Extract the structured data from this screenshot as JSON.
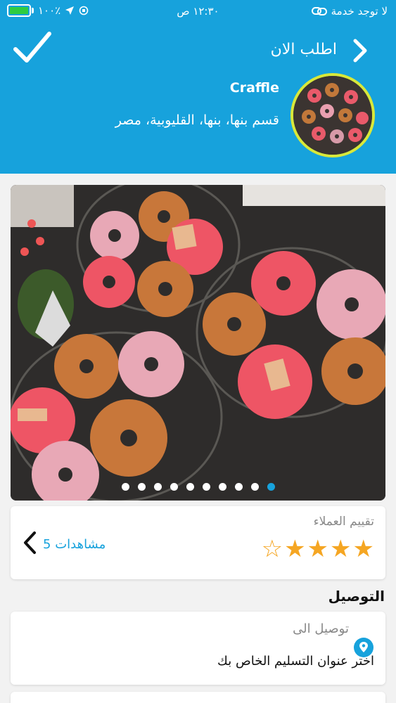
{
  "status_bar": {
    "carrier": "لا توجد خدمة",
    "time": "١٢:٣٠ ص",
    "battery": "١٠٠٪"
  },
  "header": {
    "order_now": "اطلب الان",
    "store_name": "Craffle",
    "store_location": "قسم بنها، بنها، القليوبية، مصر"
  },
  "photo": {
    "slide_count": 10,
    "active_index": 9
  },
  "rating": {
    "title": "تقييم العملاء",
    "stars_filled": 4,
    "stars_total": 5,
    "views": "5 مشاهدات"
  },
  "delivery": {
    "section_title": "التوصيل",
    "label": "توصيل الى",
    "address": "اختر عنوان التسليم الخاص بك"
  },
  "colors": {
    "accent": "#17a2dc",
    "star": "#f5a623",
    "avatar_ring": "#d8e83a"
  }
}
